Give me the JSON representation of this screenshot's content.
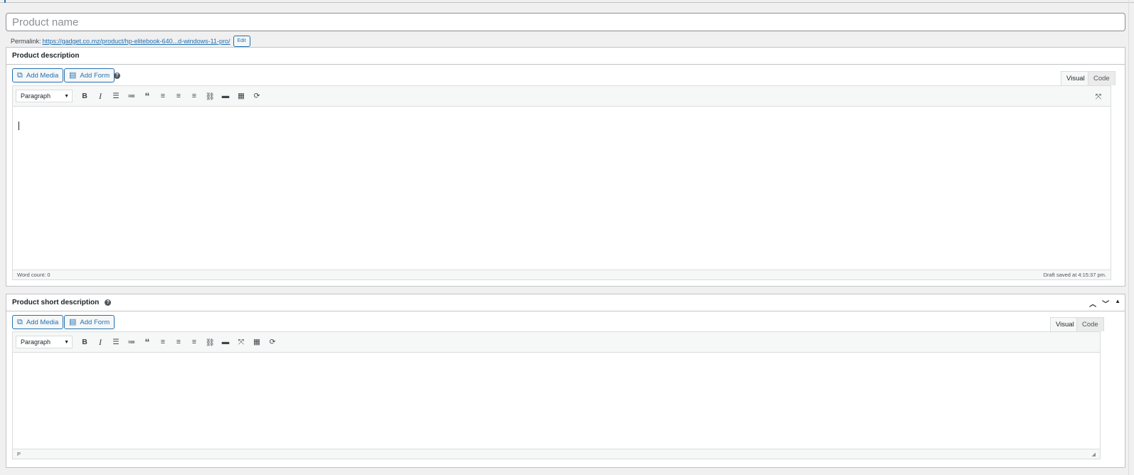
{
  "title": {
    "placeholder": "Product name",
    "value": ""
  },
  "permalink": {
    "label": "Permalink:",
    "url": "https://gadget.co.mz/product/hp-elitebook-640...d-windows-11-pro/",
    "edit_label": "Edit"
  },
  "description_box": {
    "title": "Product description",
    "add_media": "Add Media",
    "add_form": "Add Form",
    "tab_visual": "Visual",
    "tab_code": "Code",
    "format": "Paragraph",
    "word_count": "Word count: 0",
    "draft_saved": "Draft saved at 4:15:37 pm."
  },
  "short_box": {
    "title": "Product short description",
    "add_media": "Add Media",
    "add_form": "Add Form",
    "tab_visual": "Visual",
    "tab_code": "Code",
    "format": "Paragraph",
    "path": "P"
  },
  "toolbar_icons": [
    "bold-icon",
    "italic-icon",
    "bullet-list-icon",
    "numbered-list-icon",
    "blockquote-icon",
    "align-left-icon",
    "align-center-icon",
    "align-right-icon",
    "link-icon",
    "read-more-icon",
    "toolbar-toggle-icon",
    "refresh-icon",
    "fullscreen-icon"
  ],
  "colors": {
    "accent": "#2271b1",
    "border": "#c3c4c7",
    "background": "#f0f0f1"
  }
}
